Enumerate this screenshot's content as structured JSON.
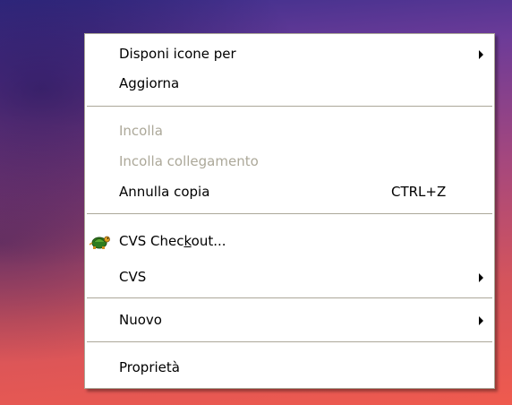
{
  "menu": {
    "view_by": {
      "label": "Disponi icone per",
      "submenu_icon": "right-arrow-icon"
    },
    "refresh": {
      "label": "Aggiorna"
    },
    "paste": {
      "label": "Incolla",
      "enabled": false
    },
    "paste_shortcut": {
      "label": "Incolla collegamento",
      "enabled": false
    },
    "undo_copy": {
      "label": "Annulla copia",
      "shortcut": "CTRL+Z"
    },
    "cvs_checkout": {
      "label_pre": "CVS Chec",
      "label_underlined": "k",
      "label_post": "out...",
      "icon": "tortoise-cvs-icon"
    },
    "cvs": {
      "label": "CVS",
      "submenu_icon": "right-arrow-icon"
    },
    "new": {
      "label": "Nuovo",
      "submenu_icon": "right-arrow-icon"
    },
    "properties": {
      "label": "Proprietà"
    }
  },
  "colors": {
    "menu_background": "#ffffff",
    "disabled_text": "#aca899",
    "separator": "#aca899"
  }
}
